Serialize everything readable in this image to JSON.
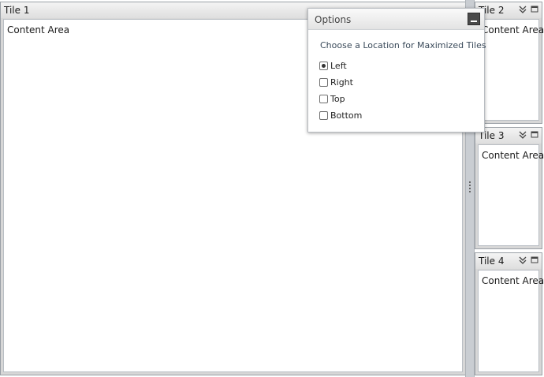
{
  "tiles": [
    {
      "title": "Tile 1",
      "content": "Content Area"
    },
    {
      "title": "Tile 2",
      "content": "Content Area"
    },
    {
      "title": "Tile 3",
      "content": "Content Area"
    },
    {
      "title": "Tile 4",
      "content": "Content Area"
    }
  ],
  "options": {
    "title": "Options",
    "heading": "Choose a Location for Maximized Tiles",
    "choices": [
      {
        "label": "Left",
        "checked": true
      },
      {
        "label": "Right",
        "checked": false
      },
      {
        "label": "Top",
        "checked": false
      },
      {
        "label": "Bottom",
        "checked": false
      }
    ]
  },
  "icons": {
    "collapse": "double-chevron-down-icon",
    "restore": "restore-window-icon",
    "minimize": "minimize-icon"
  }
}
